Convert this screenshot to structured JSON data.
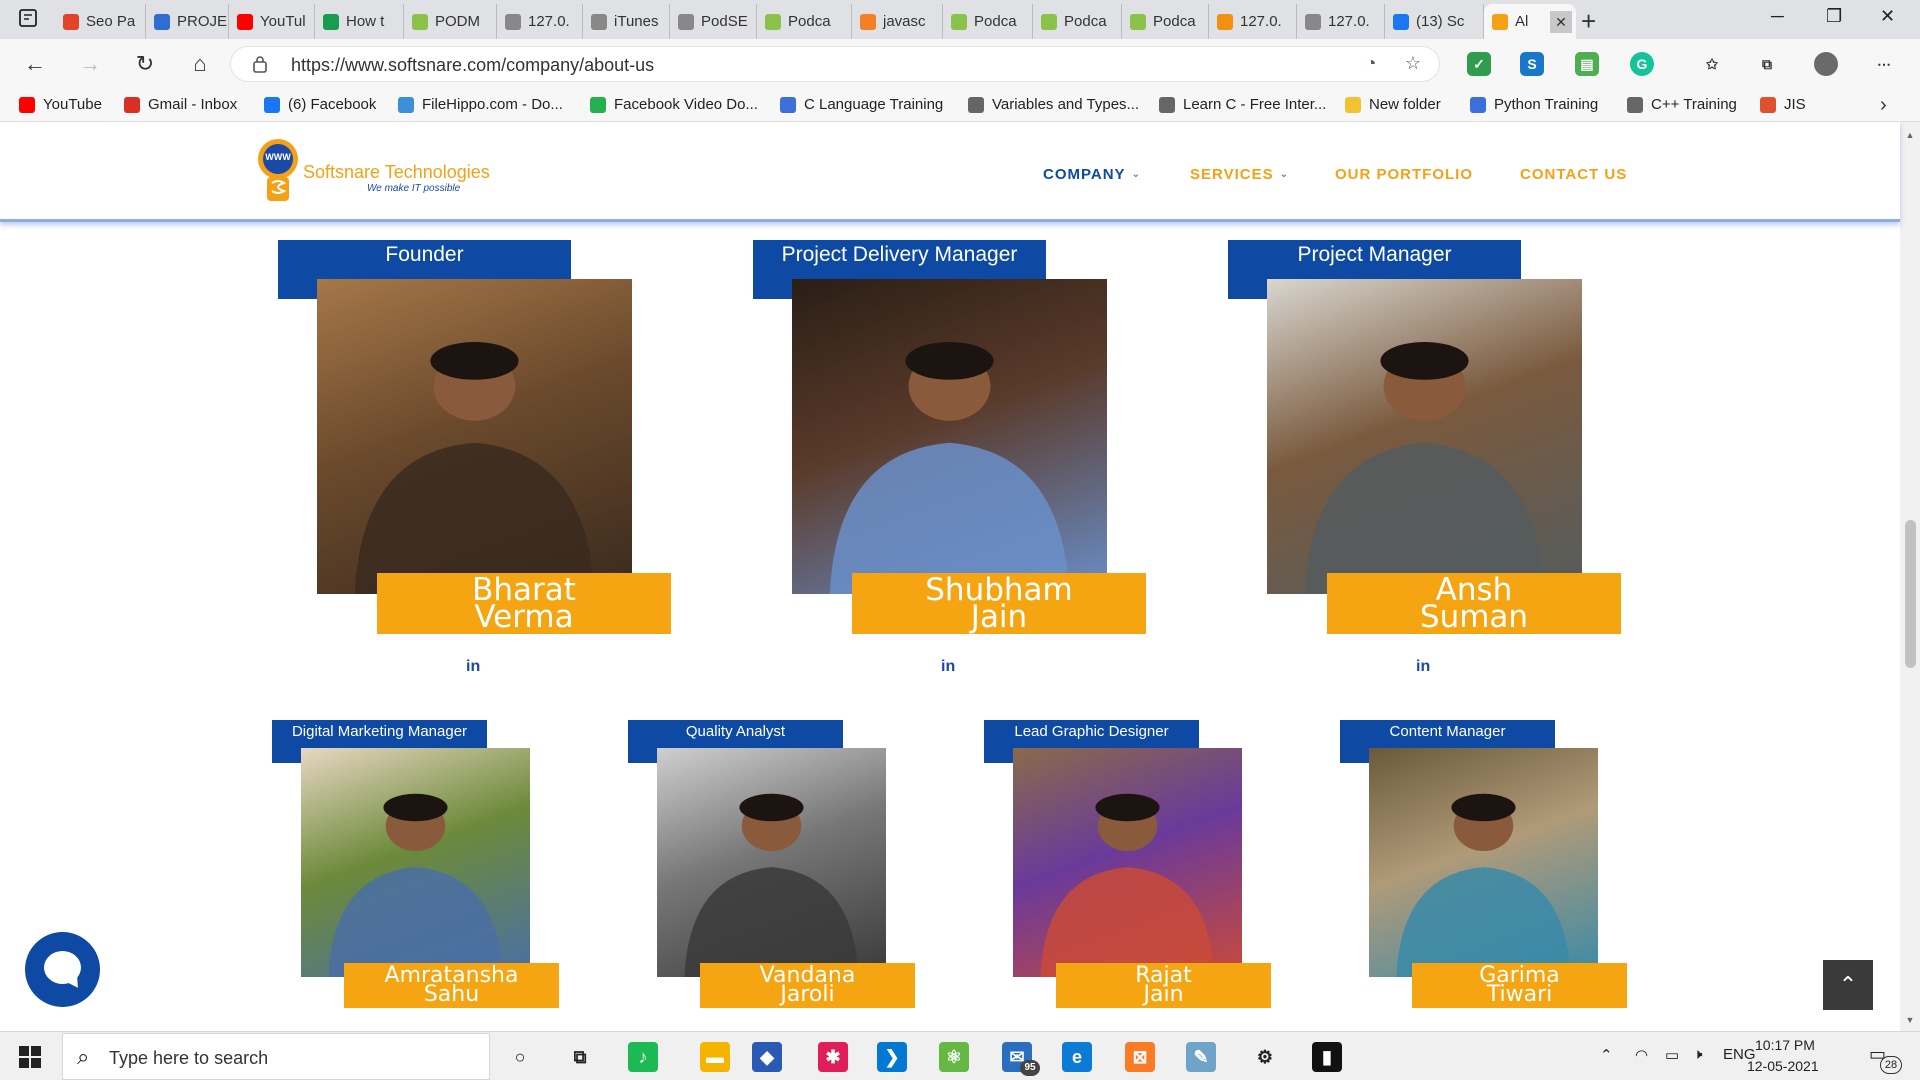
{
  "browser": {
    "tabs": [
      {
        "label": "Seo Pa",
        "icon": "gitlab-icon",
        "color": "#e24329"
      },
      {
        "label": "PROJE",
        "icon": "project-icon",
        "color": "#2f6dd5"
      },
      {
        "label": "YouTul",
        "icon": "youtube-icon",
        "color": "#ff0000"
      },
      {
        "label": "How t",
        "icon": "s-icon",
        "color": "#1a9c4f"
      },
      {
        "label": "PODM",
        "icon": "podcast-icon",
        "color": "#8bc34a"
      },
      {
        "label": "127.0.",
        "icon": "page-icon",
        "color": "#888888"
      },
      {
        "label": "iTunes",
        "icon": "page-icon",
        "color": "#888888"
      },
      {
        "label": "PodSE",
        "icon": "page-icon",
        "color": "#888888"
      },
      {
        "label": "Podca",
        "icon": "podcast-icon",
        "color": "#8bc34a"
      },
      {
        "label": "javasc",
        "icon": "stackoverflow-icon",
        "color": "#f48024"
      },
      {
        "label": "Podca",
        "icon": "podcast-icon",
        "color": "#8bc34a"
      },
      {
        "label": "Podca",
        "icon": "podcast-icon",
        "color": "#8bc34a"
      },
      {
        "label": "Podca",
        "icon": "podcast-icon",
        "color": "#8bc34a"
      },
      {
        "label": "127.0.",
        "icon": "phpmyadmin-icon",
        "color": "#f29111"
      },
      {
        "label": "127.0.",
        "icon": "page-icon",
        "color": "#888888"
      },
      {
        "label": "(13) Sc",
        "icon": "facebook-icon",
        "color": "#1877f2"
      },
      {
        "label": "Al",
        "icon": "softsnare-icon",
        "color": "#f5a015",
        "active": true
      }
    ],
    "url": "https://www.softsnare.com/company/about-us",
    "bookmarks": [
      {
        "label": "YouTube",
        "icon": "youtube-icon",
        "color": "#ff0000"
      },
      {
        "label": "Gmail - Inbox",
        "icon": "gmail-icon",
        "color": "#d93025"
      },
      {
        "label": "(6) Facebook",
        "icon": "facebook-icon",
        "color": "#1877f2"
      },
      {
        "label": "FileHippo.com - Do...",
        "icon": "filehippo-icon",
        "color": "#3b8fd9"
      },
      {
        "label": "Facebook Video Do...",
        "icon": "fvd-icon",
        "color": "#22b14c"
      },
      {
        "label": "C Language Training",
        "icon": "training-icon",
        "color": "#3b6fd9"
      },
      {
        "label": "Variables and Types...",
        "icon": "page-icon",
        "color": "#666666"
      },
      {
        "label": "Learn C - Free Inter...",
        "icon": "page-icon",
        "color": "#666666"
      },
      {
        "label": "New folder",
        "icon": "folder-icon",
        "color": "#f2c230"
      },
      {
        "label": "Python Training",
        "icon": "training-icon",
        "color": "#3b6fd9"
      },
      {
        "label": "C++ Training",
        "icon": "page-icon",
        "color": "#666666"
      },
      {
        "label": "JIS",
        "icon": "jis-icon",
        "color": "#e0522f"
      }
    ]
  },
  "site": {
    "logo_text": "Softsnare Technologies",
    "logo_tag": "We make IT possible",
    "logo_badge": "WWW",
    "nav": [
      {
        "label": "COMPANY",
        "caret": true,
        "current": true
      },
      {
        "label": "SERVICES",
        "caret": true,
        "current": false
      },
      {
        "label": "OUR PORTFOLIO",
        "caret": false,
        "current": false
      },
      {
        "label": "CONTACT US",
        "caret": false,
        "current": false
      }
    ],
    "linkedin_label": "in"
  },
  "team_row1": [
    {
      "role": "Founder",
      "first": "Bharat",
      "last": "Verma",
      "photo_colors": [
        "#6b4a2c",
        "#3a2a1e",
        "#a6774a"
      ]
    },
    {
      "role": "Project Delivery Manager",
      "first": "Shubham",
      "last": "Jain",
      "photo_colors": [
        "#5a3a2a",
        "#6a8fc9",
        "#2a1e16"
      ]
    },
    {
      "role": "Project Manager",
      "first": "Ansh",
      "last": "Suman",
      "photo_colors": [
        "#7a5a3e",
        "#555c5e",
        "#d9d6cf"
      ]
    }
  ],
  "team_row2": [
    {
      "role": "Digital Marketing Manager",
      "first": "Amratansha",
      "last": "Sahu",
      "photo_colors": [
        "#6c8a3a",
        "#4a6fa5",
        "#e8d7c2"
      ]
    },
    {
      "role": "Quality Analyst",
      "first": "Vandana",
      "last": "Jaroli",
      "photo_colors": [
        "#777777",
        "#3a3a3a",
        "#cfcfcf"
      ]
    },
    {
      "role": "Lead Graphic Designer",
      "first": "Rajat",
      "last": "Jain",
      "photo_colors": [
        "#6a3a9a",
        "#c94a3a",
        "#8a6a4a"
      ]
    },
    {
      "role": "Content Manager",
      "first": "Garima",
      "last": "Tiwari",
      "photo_colors": [
        "#b09a78",
        "#3a8aa8",
        "#6a5a3a"
      ]
    }
  ],
  "taskbar": {
    "search_placeholder": "Type here to search",
    "apps": [
      {
        "name": "task-view-icon",
        "glyph": "○",
        "color": "transparent"
      },
      {
        "name": "multitask-icon",
        "glyph": "⧉",
        "color": "transparent"
      },
      {
        "name": "spotify-icon",
        "glyph": "♪",
        "color": "#1db954"
      },
      {
        "name": "file-explorer-icon",
        "glyph": "▬",
        "color": "#f4b400"
      },
      {
        "name": "virtualbox-icon",
        "glyph": "◆",
        "color": "#2a5ab3"
      },
      {
        "name": "slack-icon",
        "glyph": "✱",
        "color": "#e01e5a"
      },
      {
        "name": "vscode-icon",
        "glyph": "❯",
        "color": "#0078d4"
      },
      {
        "name": "atom-icon",
        "glyph": "⚛",
        "color": "#66b845"
      },
      {
        "name": "mail-icon",
        "glyph": "✉",
        "color": "#2a6fbf"
      },
      {
        "name": "edge-icon",
        "glyph": "e",
        "color": "#0c7bd6"
      },
      {
        "name": "xampp-icon",
        "glyph": "⊠",
        "color": "#fb7a24"
      },
      {
        "name": "notepad-icon",
        "glyph": "✎",
        "color": "#6fa4c9"
      },
      {
        "name": "settings-icon",
        "glyph": "⚙",
        "color": "transparent"
      },
      {
        "name": "terminal-icon",
        "glyph": "▮",
        "color": "#111111"
      }
    ],
    "mail_badge": "95",
    "language": "ENG",
    "time": "10:17 PM",
    "date": "12-05-2021",
    "notifications": "28"
  }
}
